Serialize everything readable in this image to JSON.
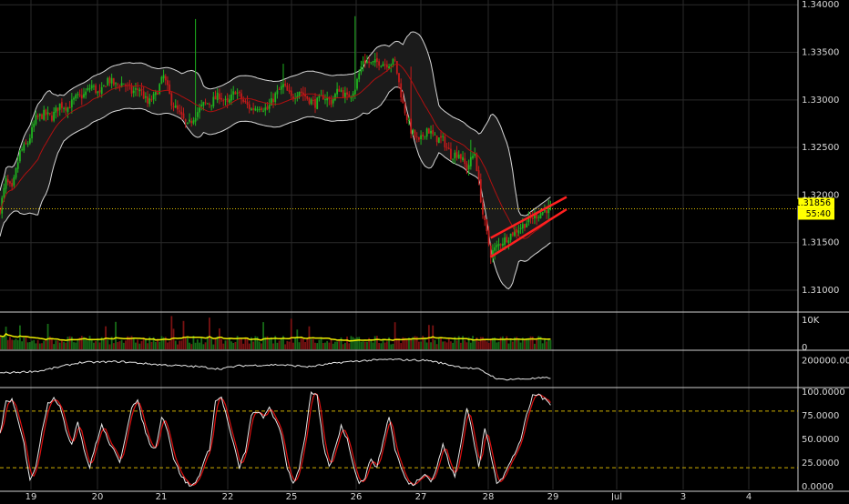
{
  "colors": {
    "background": "#000000",
    "grid": "#2a2a2a",
    "panel_border": "#cfcfcf",
    "axis_text": "#d9d9d9",
    "bull": "#1fb31f",
    "bear": "#c41a1a",
    "bollinger": "#d8d8d8",
    "moving_average": "#b01010",
    "price_line": "#e0c000",
    "price_tag_bg": "#ffff00",
    "price_tag_text": "#000000",
    "volume_ma": "#f0f000",
    "wedge": "#ff2020",
    "stoch_k": "#e8e8e8",
    "stoch_d": "#e01010",
    "level_line": "#d0b000"
  },
  "price_tag": {
    "value": "1.31856",
    "countdown": "55:40"
  },
  "chart_data": [
    {
      "name": "price",
      "type": "candlestick",
      "x_tick_labels": [
        "19",
        "20",
        "21",
        "22",
        "25",
        "26",
        "27",
        "28",
        "29",
        "Jul",
        "3",
        "4"
      ],
      "y_tick_labels": [
        "1.34000",
        "1.33500",
        "1.33000",
        "1.32500",
        "1.32000",
        "1.31500",
        "1.31000"
      ],
      "y_ticks": [
        1.34,
        1.335,
        1.33,
        1.325,
        1.32,
        1.315,
        1.31
      ],
      "ylim": [
        1.3078,
        1.3405
      ],
      "last_price": 1.31856,
      "close_path": [
        [
          0,
          1.3185
        ],
        [
          3,
          1.3215
        ],
        [
          6,
          1.3205
        ],
        [
          10,
          1.3245
        ],
        [
          14,
          1.3255
        ],
        [
          18,
          1.328
        ],
        [
          22,
          1.3285
        ],
        [
          26,
          1.3282
        ],
        [
          30,
          1.3295
        ],
        [
          34,
          1.3292
        ],
        [
          38,
          1.3302
        ],
        [
          42,
          1.3305
        ],
        [
          46,
          1.3315
        ],
        [
          50,
          1.3305
        ],
        [
          54,
          1.3322
        ],
        [
          58,
          1.3315
        ],
        [
          62,
          1.3318
        ],
        [
          66,
          1.3308
        ],
        [
          70,
          1.3312
        ],
        [
          74,
          1.3296
        ],
        [
          78,
          1.3305
        ],
        [
          82,
          1.3325
        ],
        [
          86,
          1.3298
        ],
        [
          90,
          1.3285
        ],
        [
          94,
          1.3272
        ],
        [
          98,
          1.3285
        ],
        [
          102,
          1.3295
        ],
        [
          106,
          1.3298
        ],
        [
          110,
          1.3305
        ],
        [
          114,
          1.3295
        ],
        [
          118,
          1.331
        ],
        [
          122,
          1.3298
        ],
        [
          126,
          1.329
        ],
        [
          130,
          1.3294
        ],
        [
          134,
          1.329
        ],
        [
          138,
          1.3305
        ],
        [
          142,
          1.3315
        ],
        [
          146,
          1.3302
        ],
        [
          150,
          1.331
        ],
        [
          154,
          1.3302
        ],
        [
          158,
          1.3296
        ],
        [
          162,
          1.3304
        ],
        [
          166,
          1.3298
        ],
        [
          170,
          1.3312
        ],
        [
          174,
          1.3302
        ],
        [
          178,
          1.3313
        ],
        [
          182,
          1.3342
        ],
        [
          186,
          1.3338
        ],
        [
          190,
          1.334
        ],
        [
          194,
          1.3338
        ],
        [
          198,
          1.334
        ],
        [
          202,
          1.3295
        ],
        [
          206,
          1.3268
        ],
        [
          210,
          1.3255
        ],
        [
          214,
          1.327
        ],
        [
          218,
          1.326
        ],
        [
          222,
          1.3258
        ],
        [
          226,
          1.3242
        ],
        [
          230,
          1.3244
        ],
        [
          234,
          1.3228
        ],
        [
          238,
          1.3245
        ],
        [
          242,
          1.318
        ],
        [
          246,
          1.3138
        ],
        [
          250,
          1.3148
        ],
        [
          254,
          1.3155
        ],
        [
          258,
          1.3162
        ],
        [
          262,
          1.3168
        ],
        [
          266,
          1.3175
        ],
        [
          270,
          1.318
        ],
        [
          274,
          1.3185
        ],
        [
          276,
          1.31856
        ]
      ],
      "series_names": [],
      "bollinger_bands": {
        "upper": "computed",
        "middle": "computed",
        "lower": "computed"
      },
      "wedge_lines": [
        {
          "from": [
            246,
            1.3135
          ],
          "to": [
            284,
            1.3185
          ]
        },
        {
          "from": [
            246,
            1.3155
          ],
          "to": [
            284,
            1.3198
          ]
        }
      ]
    },
    {
      "name": "volume",
      "type": "bar",
      "y_tick_labels": [
        "10K",
        "0"
      ],
      "y_ticks": [
        10000,
        0
      ],
      "ylim": [
        0,
        13000
      ]
    },
    {
      "name": "oscillator",
      "type": "line",
      "y_tick_labels": [
        "200000.0000"
      ],
      "y_ticks": [
        200000
      ],
      "ylim": [
        80000,
        240000
      ],
      "points": [
        [
          0,
          140000
        ],
        [
          20,
          150000
        ],
        [
          40,
          190000
        ],
        [
          60,
          195000
        ],
        [
          80,
          180000
        ],
        [
          100,
          170000
        ],
        [
          110,
          160000
        ],
        [
          120,
          175000
        ],
        [
          140,
          180000
        ],
        [
          155,
          170000
        ],
        [
          170,
          190000
        ],
        [
          180,
          198000
        ],
        [
          195,
          205000
        ],
        [
          215,
          200000
        ],
        [
          230,
          170000
        ],
        [
          240,
          158000
        ],
        [
          250,
          110000
        ],
        [
          262,
          112000
        ],
        [
          276,
          118000
        ]
      ]
    },
    {
      "name": "stochastic",
      "type": "line",
      "y_tick_labels": [
        "100.0000",
        "75.0000",
        "50.0000",
        "25.0000",
        "0.0000"
      ],
      "y_ticks": [
        100,
        75,
        50,
        25,
        0
      ],
      "ylim": [
        -3,
        103
      ],
      "levels": [
        80,
        20
      ],
      "k_path": [
        [
          0,
          55
        ],
        [
          3,
          90
        ],
        [
          6,
          92
        ],
        [
          9,
          70
        ],
        [
          12,
          45
        ],
        [
          15,
          8
        ],
        [
          18,
          20
        ],
        [
          21,
          60
        ],
        [
          24,
          88
        ],
        [
          27,
          95
        ],
        [
          30,
          85
        ],
        [
          33,
          60
        ],
        [
          36,
          45
        ],
        [
          39,
          70
        ],
        [
          42,
          40
        ],
        [
          45,
          20
        ],
        [
          48,
          45
        ],
        [
          51,
          65
        ],
        [
          54,
          50
        ],
        [
          57,
          38
        ],
        [
          60,
          25
        ],
        [
          63,
          55
        ],
        [
          66,
          85
        ],
        [
          69,
          90
        ],
        [
          72,
          65
        ],
        [
          75,
          45
        ],
        [
          78,
          40
        ],
        [
          81,
          75
        ],
        [
          84,
          60
        ],
        [
          87,
          30
        ],
        [
          90,
          15
        ],
        [
          93,
          5
        ],
        [
          96,
          0
        ],
        [
          99,
          8
        ],
        [
          102,
          25
        ],
        [
          105,
          40
        ],
        [
          108,
          90
        ],
        [
          111,
          95
        ],
        [
          114,
          70
        ],
        [
          117,
          45
        ],
        [
          120,
          20
        ],
        [
          123,
          38
        ],
        [
          126,
          75
        ],
        [
          129,
          80
        ],
        [
          132,
          72
        ],
        [
          135,
          85
        ],
        [
          138,
          70
        ],
        [
          141,
          55
        ],
        [
          144,
          20
        ],
        [
          147,
          3
        ],
        [
          150,
          20
        ],
        [
          153,
          55
        ],
        [
          156,
          100
        ],
        [
          159,
          95
        ],
        [
          162,
          45
        ],
        [
          165,
          20
        ],
        [
          168,
          40
        ],
        [
          171,
          65
        ],
        [
          174,
          50
        ],
        [
          177,
          25
        ],
        [
          180,
          3
        ],
        [
          183,
          10
        ],
        [
          186,
          30
        ],
        [
          189,
          20
        ],
        [
          192,
          48
        ],
        [
          195,
          75
        ],
        [
          198,
          40
        ],
        [
          201,
          20
        ],
        [
          204,
          5
        ],
        [
          207,
          2
        ],
        [
          210,
          8
        ],
        [
          213,
          15
        ],
        [
          216,
          5
        ],
        [
          219,
          20
        ],
        [
          222,
          45
        ],
        [
          225,
          25
        ],
        [
          228,
          10
        ],
        [
          231,
          45
        ],
        [
          234,
          85
        ],
        [
          237,
          55
        ],
        [
          240,
          20
        ],
        [
          243,
          62
        ],
        [
          246,
          35
        ],
        [
          249,
          5
        ],
        [
          252,
          10
        ],
        [
          255,
          22
        ],
        [
          258,
          35
        ],
        [
          261,
          50
        ],
        [
          264,
          75
        ],
        [
          267,
          96
        ],
        [
          270,
          98
        ],
        [
          273,
          92
        ],
        [
          276,
          88
        ],
        [
          278,
          92
        ]
      ]
    }
  ]
}
